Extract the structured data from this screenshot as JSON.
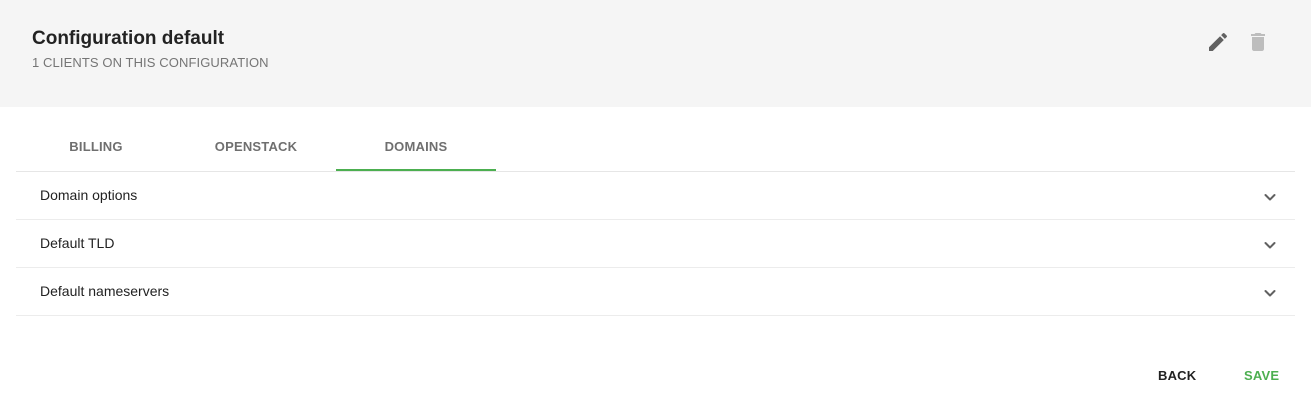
{
  "header": {
    "title": "Configuration default",
    "subtitle": "1 CLIENTS ON THIS CONFIGURATION",
    "icons": [
      "pencil-icon",
      "trash-icon"
    ]
  },
  "tabs": [
    {
      "label": "BILLING",
      "active": false
    },
    {
      "label": "OPENSTACK",
      "active": false
    },
    {
      "label": "DOMAINS",
      "active": true
    }
  ],
  "panels": [
    {
      "label": "Domain options"
    },
    {
      "label": "Default TLD"
    },
    {
      "label": "Default nameservers"
    }
  ],
  "actions": {
    "back_label": "BACK",
    "save_label": "SAVE"
  },
  "colors": {
    "accent": "#4caf50",
    "header_bg": "#f5f5f5",
    "icon_edit": "#616161",
    "icon_delete": "#bdbdbd"
  }
}
